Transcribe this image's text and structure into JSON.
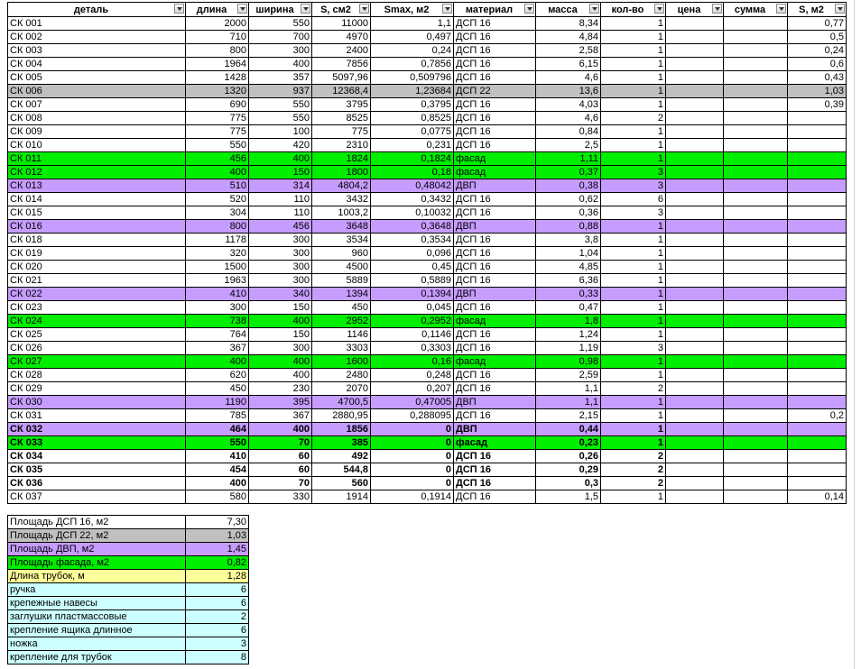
{
  "headers": [
    "деталь",
    "длина",
    "ширина",
    "S, см2",
    "Smax, м2",
    "материал",
    "масса",
    "кол-во",
    "цена",
    "сумма",
    "S, м2"
  ],
  "rows": [
    {
      "name": "СК 001",
      "l": "2000",
      "w": "550",
      "s": "11000",
      "smax": "1,1",
      "mat": "ДСП 16",
      "mass": "8,34",
      "qty": "1",
      "price": "",
      "sum": "",
      "sm2": "0,77",
      "cls": ""
    },
    {
      "name": "СК 002",
      "l": "710",
      "w": "700",
      "s": "4970",
      "smax": "0,497",
      "mat": "ДСП 16",
      "mass": "4,84",
      "qty": "1",
      "price": "",
      "sum": "",
      "sm2": "0,5",
      "cls": ""
    },
    {
      "name": "СК 003",
      "l": "800",
      "w": "300",
      "s": "2400",
      "smax": "0,24",
      "mat": "ДСП 16",
      "mass": "2,58",
      "qty": "1",
      "price": "",
      "sum": "",
      "sm2": "0,24",
      "cls": ""
    },
    {
      "name": "СК 004",
      "l": "1964",
      "w": "400",
      "s": "7856",
      "smax": "0,7856",
      "mat": "ДСП 16",
      "mass": "6,15",
      "qty": "1",
      "price": "",
      "sum": "",
      "sm2": "0,6",
      "cls": ""
    },
    {
      "name": "СК 005",
      "l": "1428",
      "w": "357",
      "s": "5097,96",
      "smax": "0,509796",
      "mat": "ДСП 16",
      "mass": "4,6",
      "qty": "1",
      "price": "",
      "sum": "",
      "sm2": "0,43",
      "cls": ""
    },
    {
      "name": "СК 006",
      "l": "1320",
      "w": "937",
      "s": "12368,4",
      "smax": "1,23684",
      "mat": "ДСП 22",
      "mass": "13,6",
      "qty": "1",
      "price": "",
      "sum": "",
      "sm2": "1,03",
      "cls": "gr"
    },
    {
      "name": "СК 007",
      "l": "690",
      "w": "550",
      "s": "3795",
      "smax": "0,3795",
      "mat": "ДСП 16",
      "mass": "4,03",
      "qty": "1",
      "price": "",
      "sum": "",
      "sm2": "0,39",
      "cls": ""
    },
    {
      "name": "СК 008",
      "l": "775",
      "w": "550",
      "s": "8525",
      "smax": "0,8525",
      "mat": "ДСП 16",
      "mass": "4,6",
      "qty": "2",
      "price": "",
      "sum": "",
      "sm2": "",
      "cls": ""
    },
    {
      "name": "СК 009",
      "l": "775",
      "w": "100",
      "s": "775",
      "smax": "0,0775",
      "mat": "ДСП 16",
      "mass": "0,84",
      "qty": "1",
      "price": "",
      "sum": "",
      "sm2": "",
      "cls": ""
    },
    {
      "name": "СК 010",
      "l": "550",
      "w": "420",
      "s": "2310",
      "smax": "0,231",
      "mat": "ДСП 16",
      "mass": "2,5",
      "qty": "1",
      "price": "",
      "sum": "",
      "sm2": "",
      "cls": ""
    },
    {
      "name": "СК 011",
      "l": "456",
      "w": "400",
      "s": "1824",
      "smax": "0,1824",
      "mat": "фасад",
      "mass": "1,11",
      "qty": "1",
      "price": "",
      "sum": "",
      "sm2": "",
      "cls": "g"
    },
    {
      "name": "СК 012",
      "l": "400",
      "w": "150",
      "s": "1800",
      "smax": "0,18",
      "mat": "фасад",
      "mass": "0,37",
      "qty": "3",
      "price": "",
      "sum": "",
      "sm2": "",
      "cls": "g"
    },
    {
      "name": "СК 013",
      "l": "510",
      "w": "314",
      "s": "4804,2",
      "smax": "0,48042",
      "mat": "ДВП",
      "mass": "0,38",
      "qty": "3",
      "price": "",
      "sum": "",
      "sm2": "",
      "cls": "v"
    },
    {
      "name": "СК 014",
      "l": "520",
      "w": "110",
      "s": "3432",
      "smax": "0,3432",
      "mat": "ДСП 16",
      "mass": "0,62",
      "qty": "6",
      "price": "",
      "sum": "",
      "sm2": "",
      "cls": ""
    },
    {
      "name": "СК 015",
      "l": "304",
      "w": "110",
      "s": "1003,2",
      "smax": "0,10032",
      "mat": "ДСП 16",
      "mass": "0,36",
      "qty": "3",
      "price": "",
      "sum": "",
      "sm2": "",
      "cls": ""
    },
    {
      "name": "СК 016",
      "l": "800",
      "w": "456",
      "s": "3648",
      "smax": "0,3648",
      "mat": "ДВП",
      "mass": "0,88",
      "qty": "1",
      "price": "",
      "sum": "",
      "sm2": "",
      "cls": "v"
    },
    {
      "name": "СК 018",
      "l": "1178",
      "w": "300",
      "s": "3534",
      "smax": "0,3534",
      "mat": "ДСП 16",
      "mass": "3,8",
      "qty": "1",
      "price": "",
      "sum": "",
      "sm2": "",
      "cls": ""
    },
    {
      "name": "СК 019",
      "l": "320",
      "w": "300",
      "s": "960",
      "smax": "0,096",
      "mat": "ДСП 16",
      "mass": "1,04",
      "qty": "1",
      "price": "",
      "sum": "",
      "sm2": "",
      "cls": ""
    },
    {
      "name": "СК 020",
      "l": "1500",
      "w": "300",
      "s": "4500",
      "smax": "0,45",
      "mat": "ДСП 16",
      "mass": "4,85",
      "qty": "1",
      "price": "",
      "sum": "",
      "sm2": "",
      "cls": ""
    },
    {
      "name": "СК 021",
      "l": "1963",
      "w": "300",
      "s": "5889",
      "smax": "0,5889",
      "mat": "ДСП 16",
      "mass": "6,36",
      "qty": "1",
      "price": "",
      "sum": "",
      "sm2": "",
      "cls": ""
    },
    {
      "name": "СК 022",
      "l": "410",
      "w": "340",
      "s": "1394",
      "smax": "0,1394",
      "mat": "ДВП",
      "mass": "0,33",
      "qty": "1",
      "price": "",
      "sum": "",
      "sm2": "",
      "cls": "v"
    },
    {
      "name": "СК 023",
      "l": "300",
      "w": "150",
      "s": "450",
      "smax": "0,045",
      "mat": "ДСП 16",
      "mass": "0,47",
      "qty": "1",
      "price": "",
      "sum": "",
      "sm2": "",
      "cls": ""
    },
    {
      "name": "СК 024",
      "l": "738",
      "w": "400",
      "s": "2952",
      "smax": "0,2952",
      "mat": "фасад",
      "mass": "1,8",
      "qty": "1",
      "price": "",
      "sum": "",
      "sm2": "",
      "cls": "g"
    },
    {
      "name": "СК 025",
      "l": "764",
      "w": "150",
      "s": "1146",
      "smax": "0,1146",
      "mat": "ДСП 16",
      "mass": "1,24",
      "qty": "1",
      "price": "",
      "sum": "",
      "sm2": "",
      "cls": ""
    },
    {
      "name": "СК 026",
      "l": "367",
      "w": "300",
      "s": "3303",
      "smax": "0,3303",
      "mat": "ДСП 16",
      "mass": "1,19",
      "qty": "3",
      "price": "",
      "sum": "",
      "sm2": "",
      "cls": ""
    },
    {
      "name": "СК 027",
      "l": "400",
      "w": "400",
      "s": "1600",
      "smax": "0,16",
      "mat": "фасад",
      "mass": "0,98",
      "qty": "1",
      "price": "",
      "sum": "",
      "sm2": "",
      "cls": "g"
    },
    {
      "name": "СК 028",
      "l": "620",
      "w": "400",
      "s": "2480",
      "smax": "0,248",
      "mat": "ДСП 16",
      "mass": "2,59",
      "qty": "1",
      "price": "",
      "sum": "",
      "sm2": "",
      "cls": ""
    },
    {
      "name": "СК 029",
      "l": "450",
      "w": "230",
      "s": "2070",
      "smax": "0,207",
      "mat": "ДСП 16",
      "mass": "1,1",
      "qty": "2",
      "price": "",
      "sum": "",
      "sm2": "",
      "cls": ""
    },
    {
      "name": "СК 030",
      "l": "1190",
      "w": "395",
      "s": "4700,5",
      "smax": "0,47005",
      "mat": "ДВП",
      "mass": "1,1",
      "qty": "1",
      "price": "",
      "sum": "",
      "sm2": "",
      "cls": "v"
    },
    {
      "name": "СК 031",
      "l": "785",
      "w": "367",
      "s": "2880,95",
      "smax": "0,288095",
      "mat": "ДСП 16",
      "mass": "2,15",
      "qty": "1",
      "price": "",
      "sum": "",
      "sm2": "0,2",
      "cls": ""
    },
    {
      "name": "СК 032",
      "l": "464",
      "w": "400",
      "s": "1856",
      "smax": "0",
      "mat": "ДВП",
      "mass": "0,44",
      "qty": "1",
      "price": "",
      "sum": "",
      "sm2": "",
      "cls": "v b"
    },
    {
      "name": "СК 033",
      "l": "550",
      "w": "70",
      "s": "385",
      "smax": "0",
      "mat": "фасад",
      "mass": "0,23",
      "qty": "1",
      "price": "",
      "sum": "",
      "sm2": "",
      "cls": "g b"
    },
    {
      "name": "СК 034",
      "l": "410",
      "w": "60",
      "s": "492",
      "smax": "0",
      "mat": "ДСП 16",
      "mass": "0,26",
      "qty": "2",
      "price": "",
      "sum": "",
      "sm2": "",
      "cls": "b"
    },
    {
      "name": "СК 035",
      "l": "454",
      "w": "60",
      "s": "544,8",
      "smax": "0",
      "mat": "ДСП 16",
      "mass": "0,29",
      "qty": "2",
      "price": "",
      "sum": "",
      "sm2": "",
      "cls": "b"
    },
    {
      "name": "СК 036",
      "l": "400",
      "w": "70",
      "s": "560",
      "smax": "0",
      "mat": "ДСП 16",
      "mass": "0,3",
      "qty": "2",
      "price": "",
      "sum": "",
      "sm2": "",
      "cls": "b"
    },
    {
      "name": "СК 037",
      "l": "580",
      "w": "330",
      "s": "1914",
      "smax": "0,1914",
      "mat": "ДСП 16",
      "mass": "1,5",
      "qty": "1",
      "price": "",
      "sum": "",
      "sm2": "0,14",
      "cls": ""
    }
  ],
  "summary": [
    {
      "label": "Площадь ДСП 16, м2",
      "value": "7,30",
      "cls": ""
    },
    {
      "label": "Площадь ДСП 22, м2",
      "value": "1,03",
      "cls": "s-dsp22"
    },
    {
      "label": "Площадь ДВП, м2",
      "value": "1,45",
      "cls": "s-dvp"
    },
    {
      "label": "Площадь фасада, м2",
      "value": "0,82",
      "cls": "s-facade"
    },
    {
      "label": "Длина трубок, м",
      "value": "1,28",
      "cls": "s-tube"
    },
    {
      "label": "ручка",
      "value": "6",
      "cls": "s-acc"
    },
    {
      "label": "крепежные навесы",
      "value": "6",
      "cls": "s-acc"
    },
    {
      "label": "заглушки пластмассовые",
      "value": "2",
      "cls": "s-acc"
    },
    {
      "label": "крепление ящика длинное",
      "value": "6",
      "cls": "s-acc"
    },
    {
      "label": "ножка",
      "value": "3",
      "cls": "s-acc"
    },
    {
      "label": "крепление для трубок",
      "value": "8",
      "cls": "s-acc"
    }
  ],
  "colors": {
    "facade_green": "#00ee00",
    "dvp_violet": "#c69cff",
    "dsp22_gray": "#c0c0c0",
    "tube_yellow": "#ffff99",
    "accessory_cyan": "#ccffff"
  }
}
